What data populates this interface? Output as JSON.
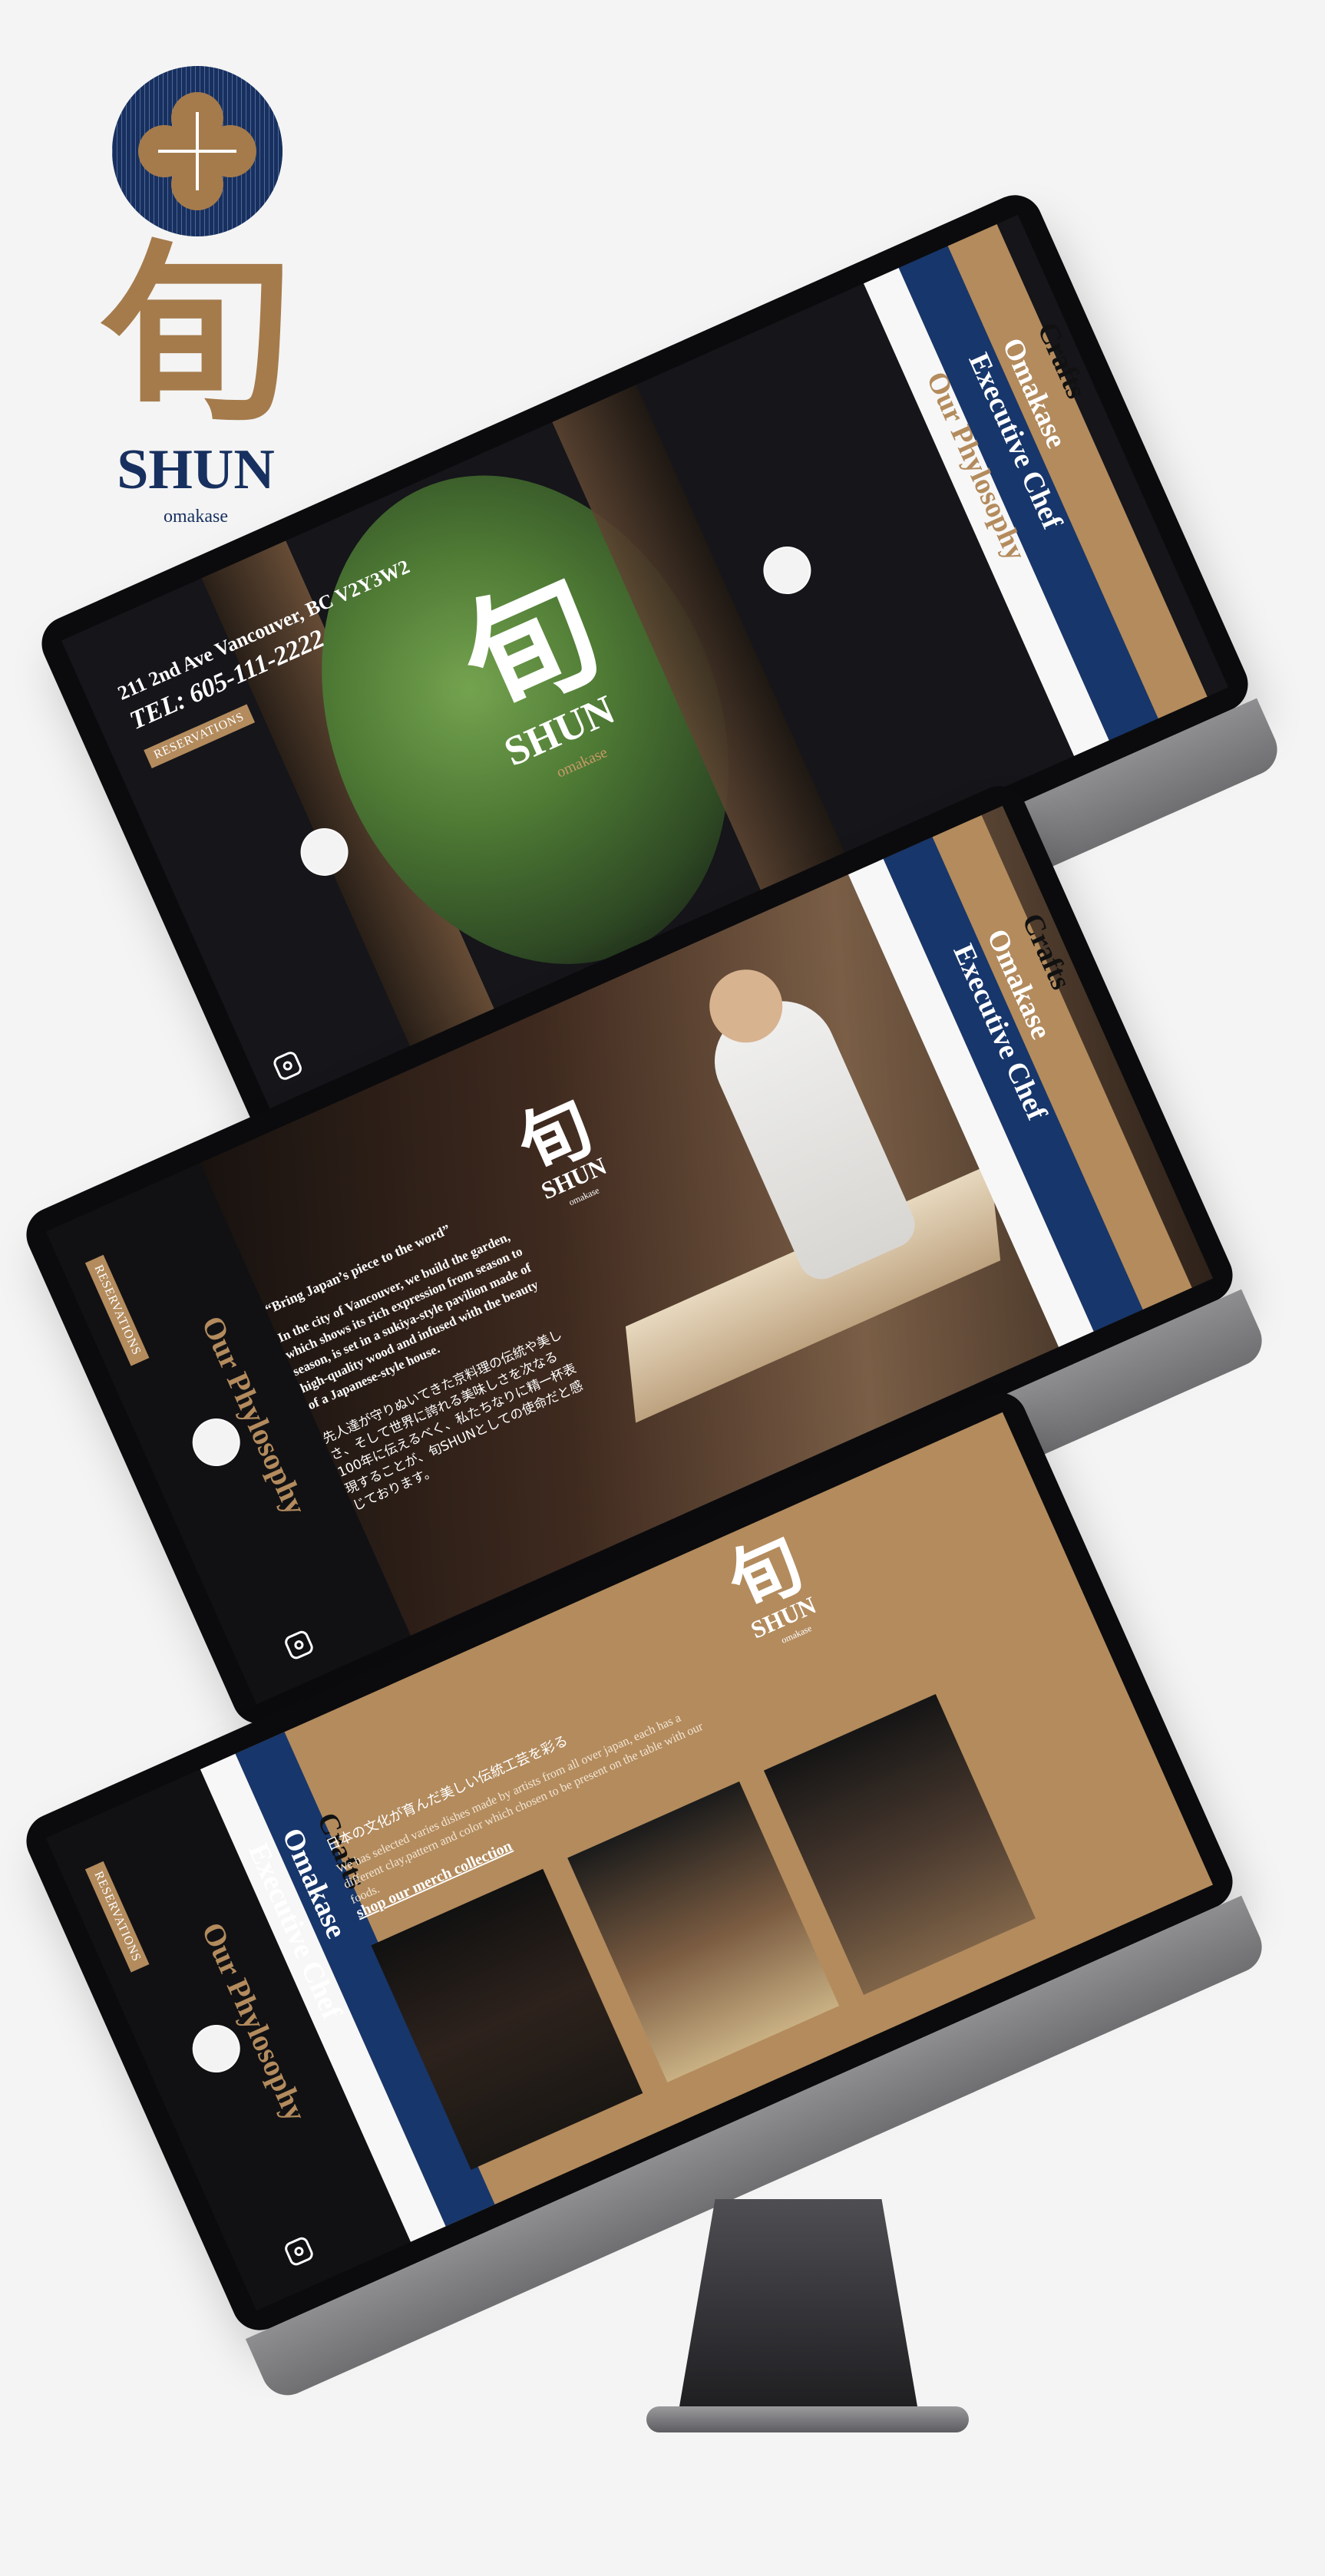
{
  "brand": {
    "kanji": "旬",
    "name": "SHUN",
    "subtitle": "omakase"
  },
  "screen1": {
    "address": "211 2nd Ave Vancouver, BC V2Y3W2",
    "tel": "TEL: 605-111-2222",
    "reservations": "RESERVATIONS",
    "logo": {
      "kanji": "旬",
      "name": "SHUN",
      "subtitle": "omakase"
    },
    "menu": [
      "Crafts",
      "Omakase",
      "Executive Chef",
      "Our Phylosophy"
    ]
  },
  "screen2": {
    "reservations": "RESERVATIONS",
    "philosophy": "Our Phylosophy",
    "quote": "“Bring Japan’s piece to the word”",
    "english": "In the city of Vancouver, we build the garden, which shows its rich expression from season to season, is set in a sukiya-style pavilion made of high-quality wood and infused with the beauty of a Japanese-style house.",
    "japanese": "先人達が守りぬいてきた京料理の伝統や美しさ、そして世界に誇れる美味しさを次なる100年に伝えるべく、私たちなりに精一杯表現することが、旬SHUNとしての使命だと感じております。",
    "logo": {
      "kanji": "旬",
      "name": "SHUN",
      "subtitle": "omakase"
    },
    "menu": [
      "Crafts",
      "Omakase",
      "Executive Chef"
    ]
  },
  "screen3": {
    "reservations": "RESERVATIONS",
    "title": "日本の文化が育んだ美しい伝統工芸を彩る",
    "description": "We has selected varies dishes made by artists from all over japan, each has a different clay,pattern and color which chosen to be present on the table with our foods.",
    "link": "shop our merch collection",
    "logo": {
      "kanji": "旬",
      "name": "SHUN",
      "subtitle": "omakase"
    },
    "menu": [
      "Crafts",
      "Omakase",
      "Executive Chef",
      "Our Phylosophy"
    ]
  },
  "colors": {
    "gold": "#b38b5d",
    "navy": "#17366b",
    "dark": "#111114"
  },
  "icons": {
    "flower": "flower-icon",
    "instagram": "instagram-icon",
    "apple": "apple-logo-icon"
  }
}
